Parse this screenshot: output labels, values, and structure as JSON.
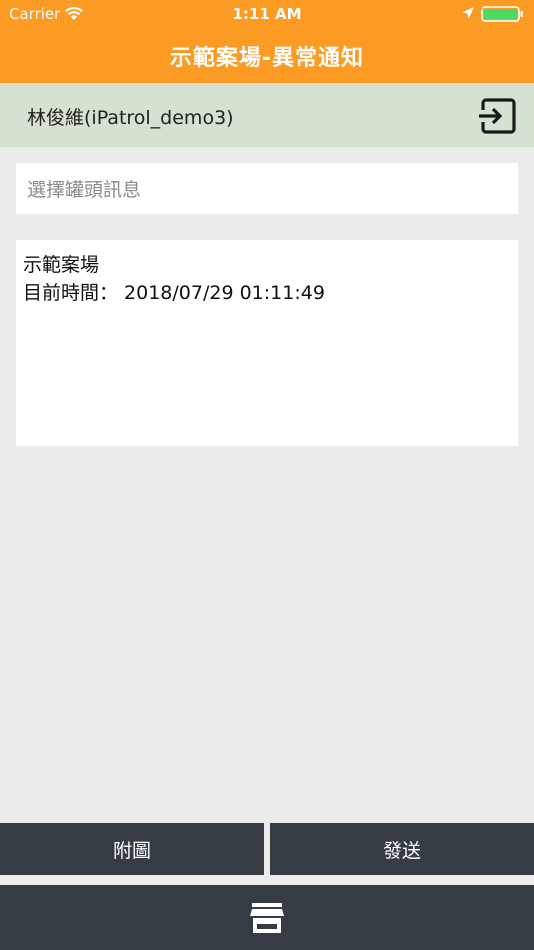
{
  "status_bar": {
    "carrier": "Carrier",
    "time": "1:11 AM",
    "battery_color": "#4cd964"
  },
  "nav": {
    "title": "示範案場-異常通知",
    "background_color": "#fb9b23"
  },
  "user": {
    "name": "林俊維(iPatrol_demo3)",
    "logout_icon": "logout-icon",
    "bar_color": "#d5e2d1"
  },
  "tank_select": {
    "placeholder": "選擇罐頭訊息"
  },
  "message": {
    "line1": "示範案場",
    "line2": "目前時間： 2018/07/29 01:11:49"
  },
  "actions": {
    "attach_label": "附圖",
    "send_label": "發送",
    "button_color": "#363c44"
  },
  "bottom_nav": {
    "icon": "store-icon"
  }
}
